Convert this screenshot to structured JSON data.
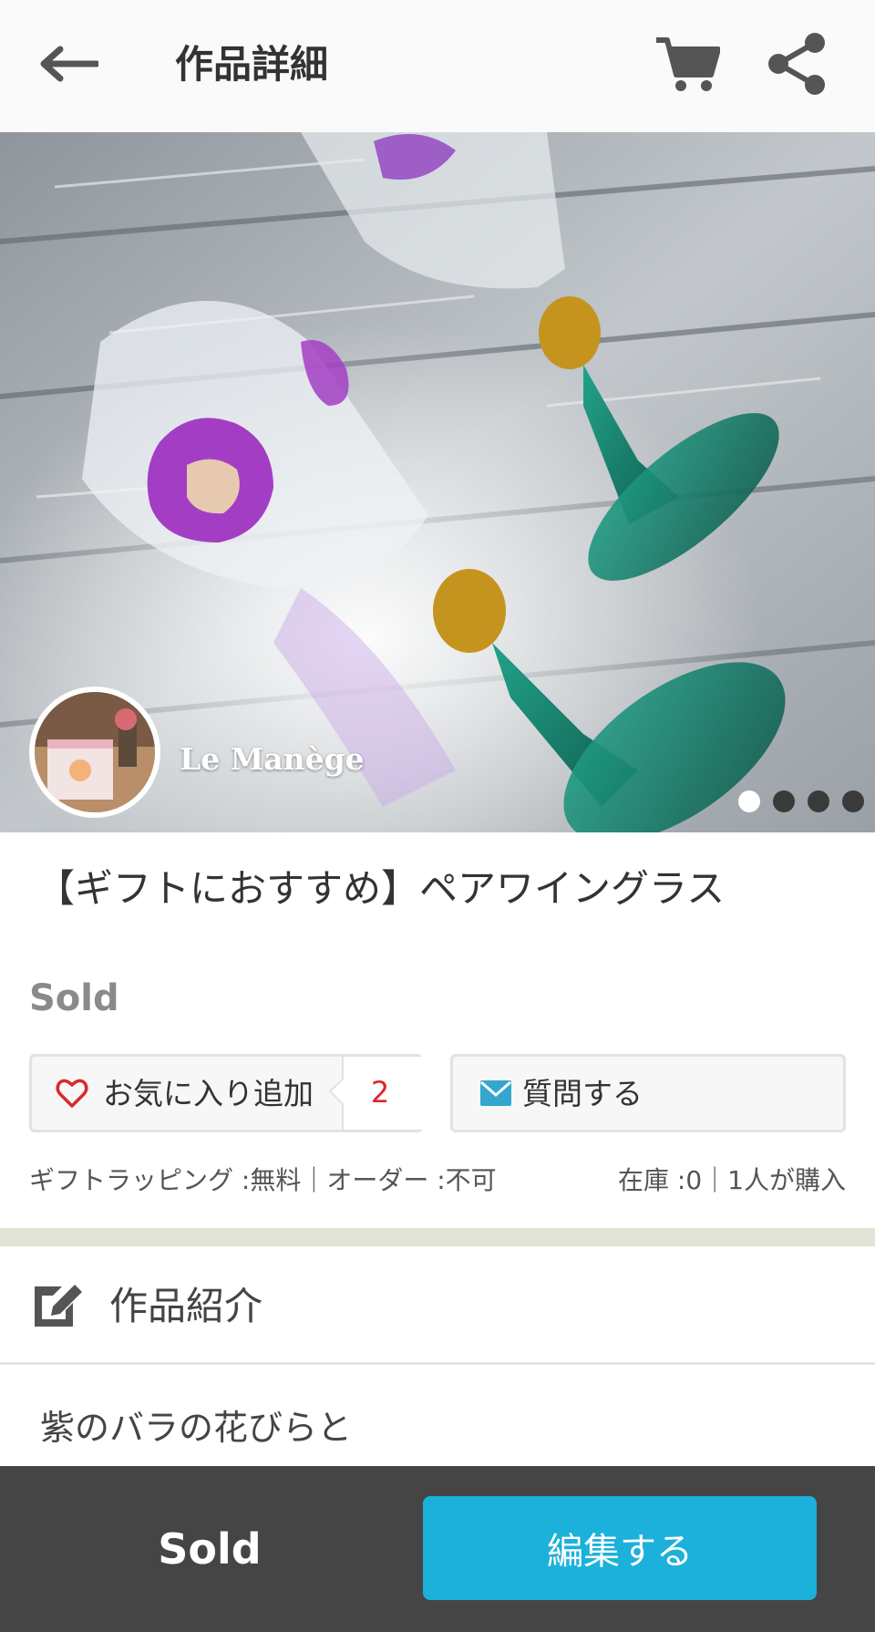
{
  "header": {
    "title": "作品詳細",
    "back_icon": "arrow-left-icon",
    "cart_icon": "cart-icon",
    "share_icon": "share-icon"
  },
  "hero": {
    "shop_name": "Le Manège",
    "image_count": 4,
    "active_image": 1
  },
  "product": {
    "title": "【ギフトにおすすめ】ペアワイングラス",
    "status": "Sold",
    "favorite_label": "お気に入り追加",
    "favorite_count": "2",
    "ask_label": "質問する",
    "meta_left": "ギフトラッピング :無料｜オーダー :不可",
    "meta_right": "在庫 :0｜1人が購入"
  },
  "section": {
    "title": "作品紹介",
    "description_line1": "紫のバラの花びらと"
  },
  "bottom_bar": {
    "sold_label": "Sold",
    "edit_label": "編集する"
  },
  "colors": {
    "accent": "#1cb1db",
    "bottom_bar": "#454545",
    "favorite_count": "#d8282c",
    "separator": "#e3e3d6"
  }
}
